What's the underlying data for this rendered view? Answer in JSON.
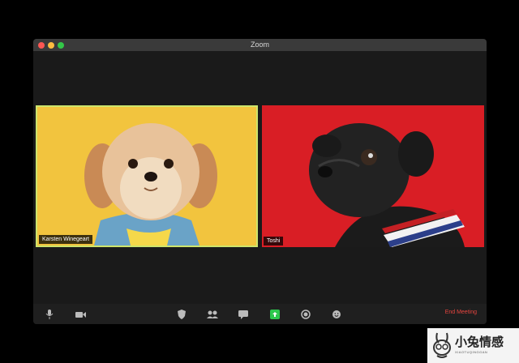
{
  "window": {
    "title": "Zoom"
  },
  "participants": [
    {
      "name": "Karsten Winegeart",
      "active_speaker": true,
      "background_color": "#f2c43e"
    },
    {
      "name": "Toshi",
      "active_speaker": false,
      "background_color": "#d91e25"
    }
  ],
  "toolbar": {
    "buttons": [
      {
        "icon": "microphone-icon",
        "label": ""
      },
      {
        "icon": "video-camera-icon",
        "label": ""
      },
      {
        "icon": "security-shield-icon",
        "label": ""
      },
      {
        "icon": "participants-icon",
        "label": ""
      },
      {
        "icon": "chat-icon",
        "label": ""
      },
      {
        "icon": "share-screen-icon",
        "label": ""
      },
      {
        "icon": "record-icon",
        "label": ""
      },
      {
        "icon": "reactions-icon",
        "label": ""
      }
    ],
    "end_label": "End Meeting"
  },
  "watermark": {
    "text": "小兔情感",
    "sub": "XIAOTUQINGGAN"
  },
  "colors": {
    "end_meeting": "#e7453f",
    "share_button": "#2dc84d",
    "active_border": "#cde56c"
  }
}
